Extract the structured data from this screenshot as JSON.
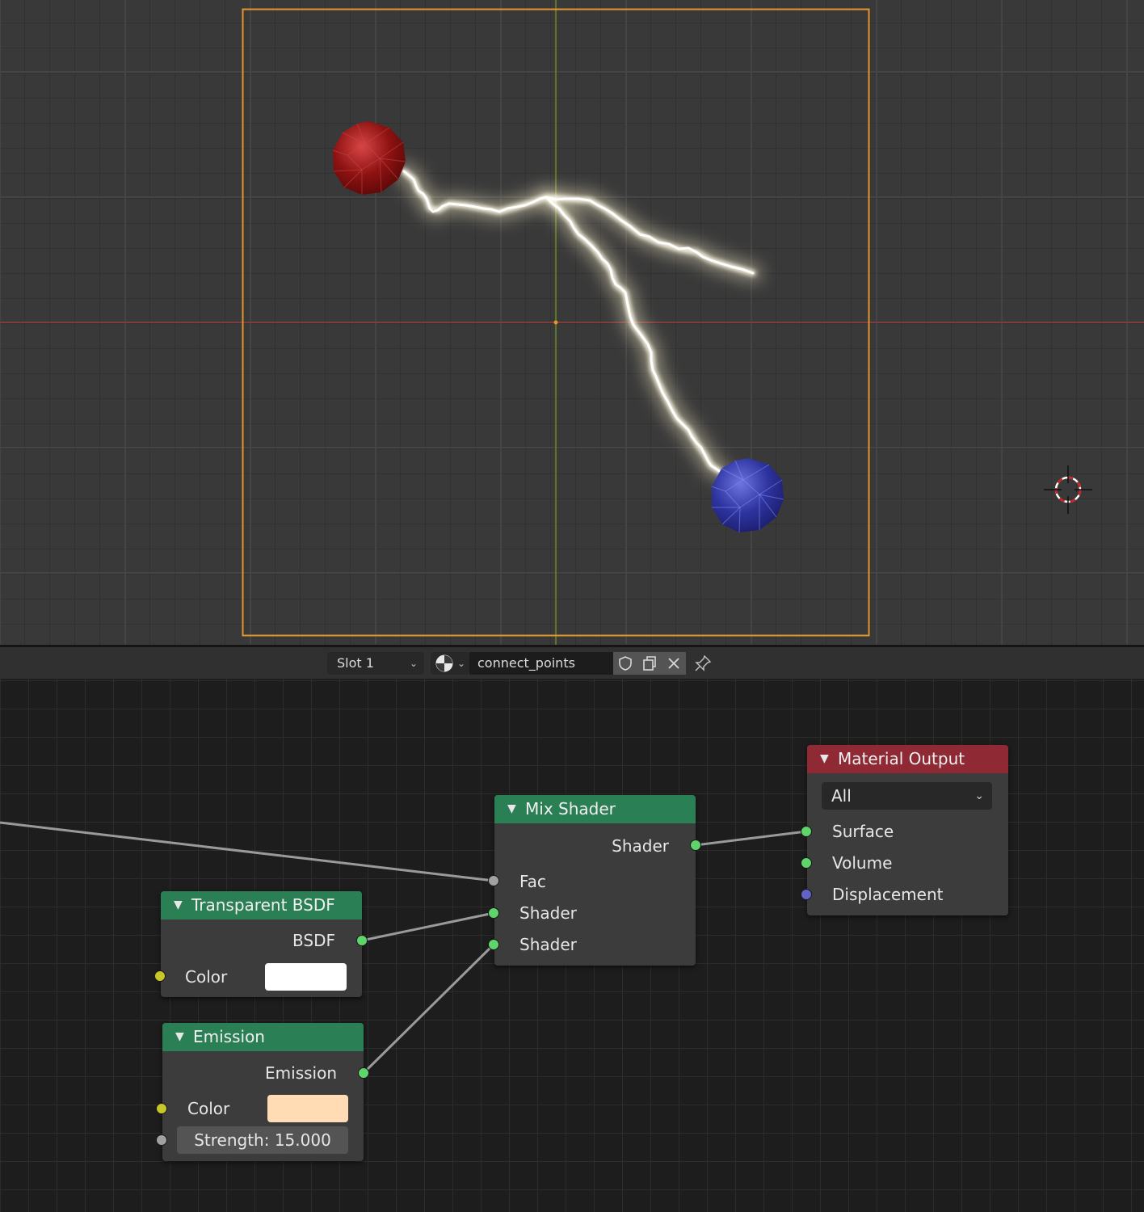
{
  "material_header": {
    "slot_label": "Slot 1",
    "material_name": "connect_points",
    "icons": [
      "material-sphere-icon",
      "fake-user-shield-icon",
      "duplicate-icon",
      "unlink-x-icon",
      "pin-icon"
    ]
  },
  "viewport": {
    "camera_frame_color": "#e0952a",
    "x_axis_color": "#8f3b3b",
    "y_axis_color": "#6a8a1f",
    "sphere_colors": {
      "start": "#8e1212",
      "end": "#2e34a0"
    }
  },
  "nodes": {
    "mix_shader": {
      "title": "Mix Shader",
      "output_label": "Shader",
      "inputs": [
        "Fac",
        "Shader",
        "Shader"
      ]
    },
    "material_output": {
      "title": "Material Output",
      "target_value": "All",
      "inputs": [
        "Surface",
        "Volume",
        "Displacement"
      ]
    },
    "transparent_bsdf": {
      "title": "Transparent BSDF",
      "output_label": "BSDF",
      "color_label": "Color",
      "color_value": "#ffffff"
    },
    "emission": {
      "title": "Emission",
      "output_label": "Emission",
      "color_label": "Color",
      "color_value": "#ffdcb4",
      "strength_text": "Strength: 15.000"
    }
  },
  "colors": {
    "shader_header": "#2b7f55",
    "output_header": "#8f2a34",
    "shader_socket": "#5fd46a",
    "color_socket": "#c7c729",
    "value_socket": "#a1a1a1",
    "vector_socket": "#6363c7"
  }
}
